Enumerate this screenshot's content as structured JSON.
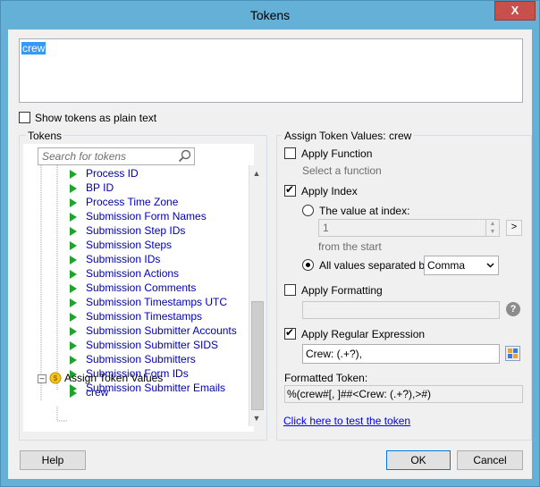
{
  "window": {
    "title": "Tokens",
    "close_label": "X"
  },
  "token_text": "crew",
  "show_plain_text": {
    "label": "Show tokens as plain text",
    "checked": false
  },
  "tokens_panel": {
    "title": "Tokens",
    "search_placeholder": "Search for tokens",
    "items": [
      "Process ID",
      "BP ID",
      "Process Time Zone",
      "Submission Form Names",
      "Submission Step IDs",
      "Submission Steps",
      "Submission IDs",
      "Submission Actions",
      "Submission Comments",
      "Submission Timestamps UTC",
      "Submission Timestamps",
      "Submission Submitter Accounts",
      "Submission Submitter SIDS",
      "Submission Submitters",
      "Submission Form IDs",
      "Submission Submitter Emails"
    ],
    "group_label": "Assign Token Values",
    "group_child": "crew"
  },
  "assign_panel": {
    "title": "Assign Token Values: crew",
    "apply_function": {
      "label": "Apply Function",
      "checked": false,
      "hint": "Select a function"
    },
    "apply_index": {
      "label": "Apply Index",
      "checked": true
    },
    "value_at_index": {
      "label": "The value at index:",
      "value": "1",
      "hint": "from the  start",
      "more": ">"
    },
    "all_values": {
      "label": "All values separated by:",
      "selected": "Comma"
    },
    "apply_formatting": {
      "label": "Apply Formatting",
      "checked": false,
      "help": "?"
    },
    "apply_regex": {
      "label": "Apply Regular Expression",
      "checked": true,
      "value": "Crew: (.+?),"
    },
    "formatted_token": {
      "label": "Formatted Token:",
      "value": "%(crew#[, ]##<Crew: (.+?),>#)"
    },
    "test_link": "Click here to test the token"
  },
  "buttons": {
    "help": "Help",
    "ok": "OK",
    "cancel": "Cancel"
  }
}
